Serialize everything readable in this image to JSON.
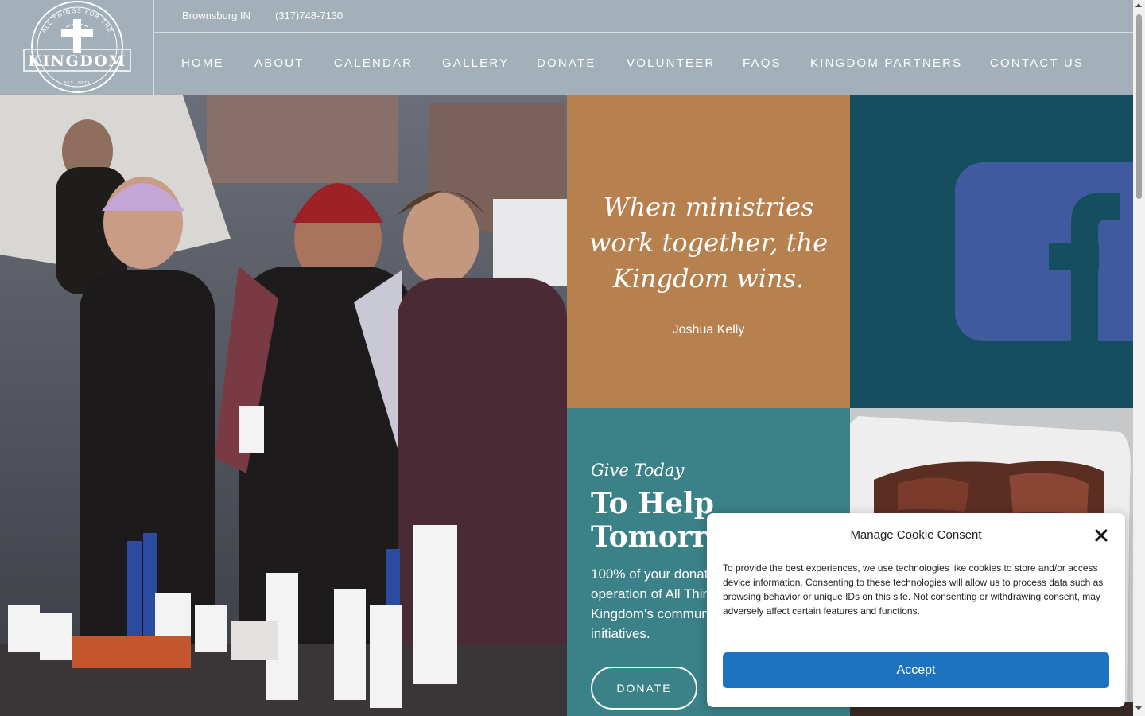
{
  "header": {
    "logo": {
      "arc_text": "ALL THINGS FOR THE",
      "name": "KINGDOM",
      "est": "EST. 2021"
    },
    "location": "Brownsburg IN",
    "phone": "(317)748-7130",
    "nav": [
      "HOME",
      "ABOUT",
      "CALENDAR",
      "GALLERY",
      "DONATE",
      "VOLUNTEER",
      "FAQS",
      "KINGDOM PARTNERS",
      "CONTACT US"
    ]
  },
  "hero": {
    "photo_label": "Volunteers serving hot drinks outdoors",
    "quote": {
      "text": "When ministries work together, the Kingdom wins.",
      "author": "Joshua Kelly"
    },
    "social": {
      "icon": "facebook-icon"
    },
    "give": {
      "eyebrow": "Give Today",
      "title_line1": "To Help",
      "title_line2": "Tomorrow",
      "body": "100% of your donation supports the operation of All Things for the Kingdom's community outreach initiatives.",
      "button": "DONATE"
    },
    "food_photo_label": "Food tray with cooked meat"
  },
  "cookie": {
    "title": "Manage Cookie Consent",
    "text": "To provide the best experiences, we use technologies like cookies to store and/or access device information. Consenting to these technologies will allow us to process data such as browsing behavior or unique IDs on this site. Not consenting or withdrawing consent, may adversely affect certain features and functions.",
    "accept_label": "Accept"
  },
  "colors": {
    "header_bg": "#a3afb9",
    "quote_bg": "#b6804f",
    "facebook_bg": "#154e5e",
    "facebook_icon": "#3f5a9e",
    "give_bg": "#3b8288",
    "accept_button": "#1e73be"
  }
}
